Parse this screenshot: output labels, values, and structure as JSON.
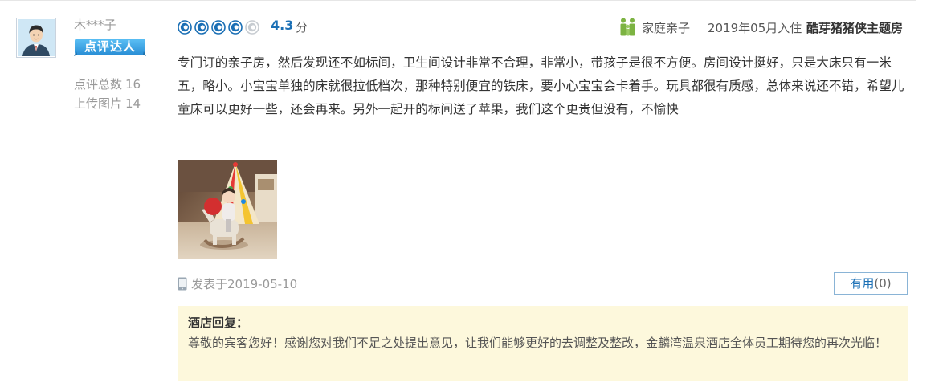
{
  "user": {
    "name": "木***子",
    "badge": "点评达人",
    "stats": [
      {
        "label": "点评总数",
        "value": "16"
      },
      {
        "label": "上传图片",
        "value": "14"
      }
    ]
  },
  "rating": {
    "value": 4.3,
    "score_text": "4.3",
    "unit": "分",
    "full_icons": 4,
    "total_icons": 5
  },
  "trip": {
    "type": "家庭亲子",
    "stay_date": "2019年05月入住",
    "room": "酷芽猪猪侠主题房"
  },
  "review_text": "专门订的亲子房，然后发现还不如标间，卫生间设计非常不合理，非常小，带孩子是很不方便。房间设计挺好，只是大床只有一米五，略小。小宝宝单独的床就很拉低档次，那种特别便宜的铁床，要小心宝宝会卡着手。玩具都很有质感，总体来说还不错，希望儿童床可以更好一些，还会再来。另外一起开的标间送了苹果，我们这个更贵但没有，不愉快",
  "posted": "发表于2019-05-10",
  "helpful": {
    "label": "有用",
    "count": "(0)"
  },
  "hotel_reply": {
    "title": "酒店回复：",
    "text": "尊敬的宾客您好！感谢您对我们不足之处提出意见，让我们能够更好的去调整及整改，金麟湾温泉酒店全体员工期待您的再次光临！"
  },
  "colors": {
    "accent_blue": "#1a6fb5",
    "badge_blue": "#3ba3e6",
    "family_green": "#7cb342",
    "reply_bg": "#fdf8dc"
  },
  "icons": [
    "user-avatar",
    "rating-circle-icon",
    "family-icon",
    "mobile-phone-icon"
  ]
}
